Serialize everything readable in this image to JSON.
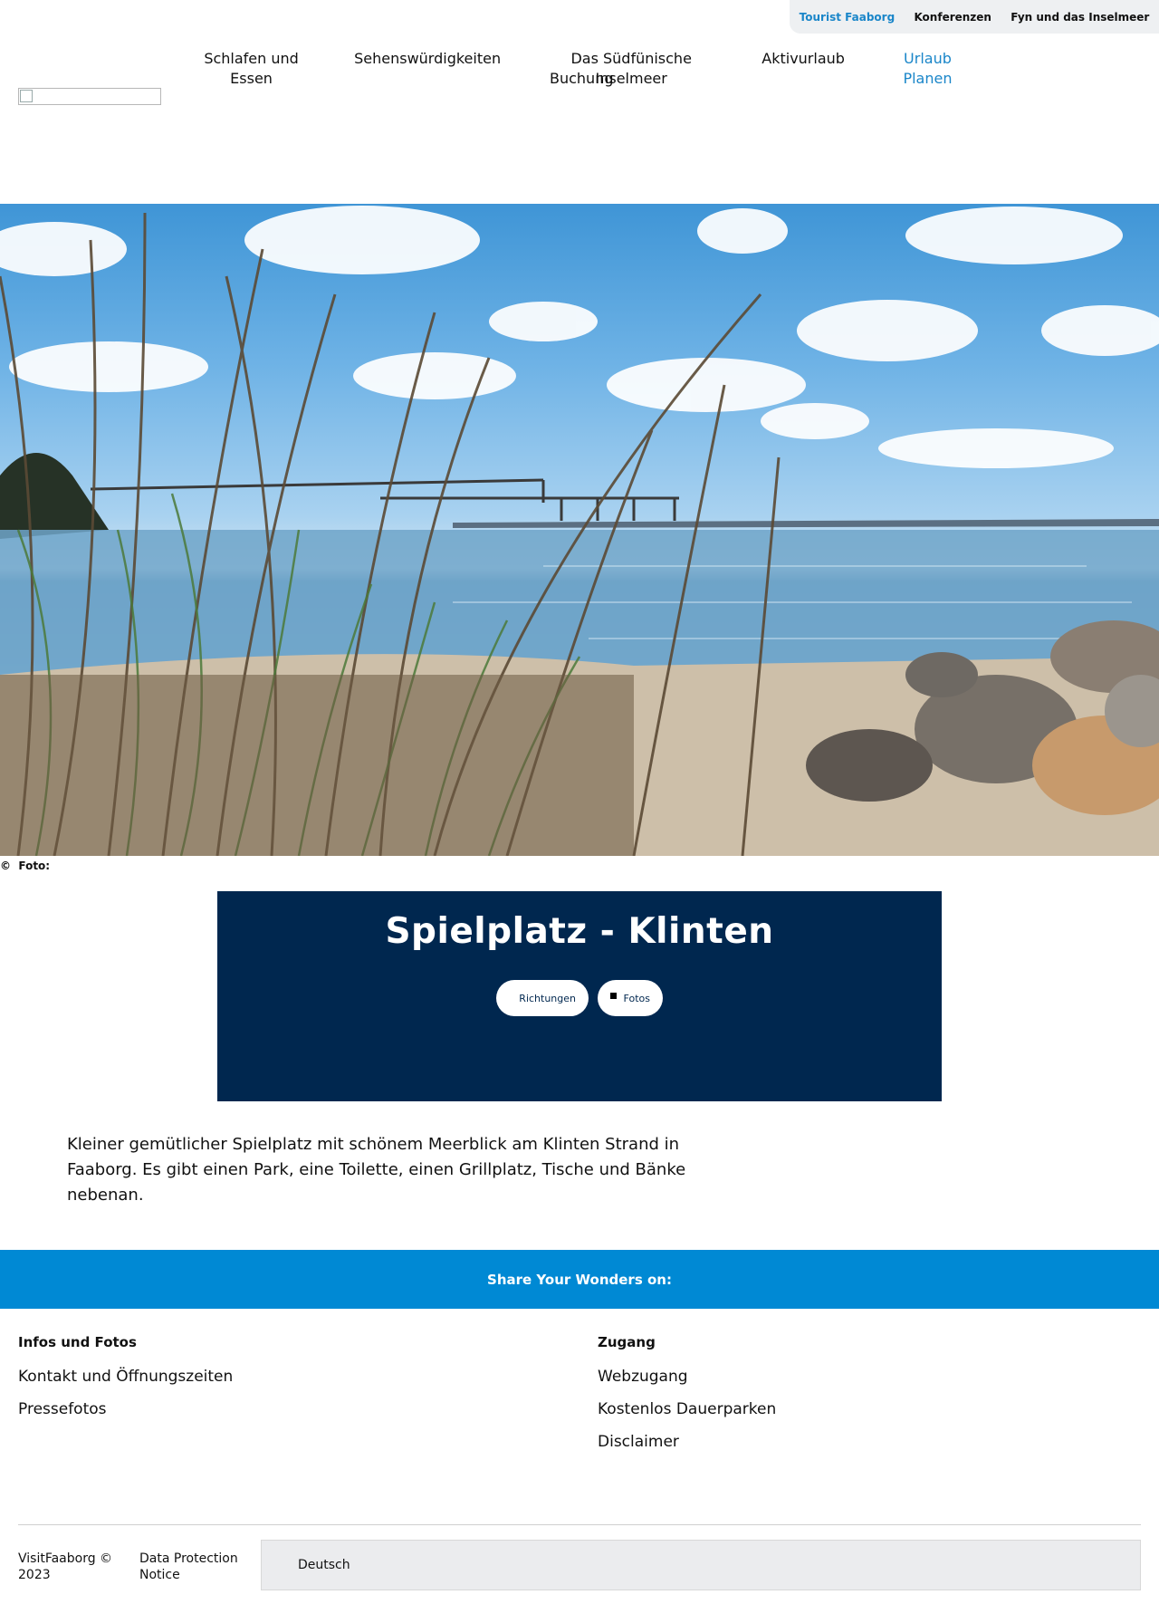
{
  "utility_nav": {
    "items": [
      "Tourist Faaborg",
      "Konferenzen",
      "Fyn und das Inselmeer"
    ]
  },
  "main_nav": {
    "items": [
      "Schlafen und Essen",
      "Sehenswürdigkeiten",
      "Das Südfünische Inselmeer",
      "Aktivurlaub",
      "Urlaub Planen",
      "Buchung"
    ]
  },
  "hero": {
    "credit_symbol": "©",
    "credit_label": "Foto:"
  },
  "card": {
    "title": "Spielplatz - Klinten",
    "directions_label": "Richtungen",
    "photos_label": "Fotos"
  },
  "intro": {
    "text": "Kleiner gemütlicher Spielplatz mit schönem Meerblick am Klinten Strand in Faaborg. Es gibt einen Park, eine Toilette, einen Grillplatz, Tische und Bänke nebenan."
  },
  "share": {
    "label": "Share Your Wonders on:"
  },
  "footer": {
    "col1": {
      "heading": "Infos und Fotos",
      "links": [
        "Kontakt und Öffnungszeiten",
        "Pressefotos"
      ]
    },
    "col2": {
      "heading": "Zugang",
      "links": [
        "Webzugang",
        "Kostenlos Dauerparken",
        "Disclaimer"
      ]
    },
    "copyright": "VisitFaaborg © 2023",
    "data_protection": "Data Protection Notice",
    "language": "Deutsch"
  },
  "colors": {
    "accent": "#1a86c9",
    "card_bg": "#00274f",
    "share_bg": "#0089d4"
  }
}
